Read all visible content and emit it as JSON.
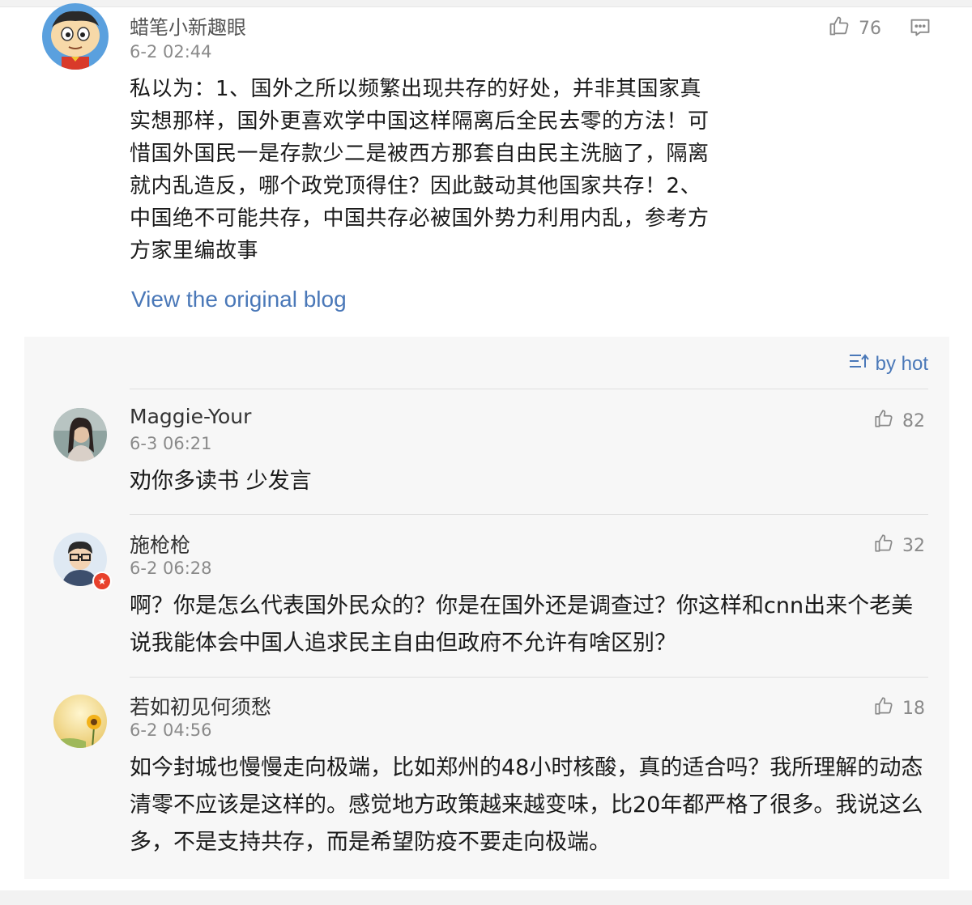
{
  "post": {
    "author": "蜡笔小新趣眼",
    "time": "6-2 02:44",
    "likes": "76",
    "body": "私以为：1、国外之所以频繁出现共存的好处，并非其国家真实想那样，国外更喜欢学中国这样隔离后全民去零的方法！可惜国外国民一是存款少二是被西方那套自由民主洗脑了，隔离就内乱造反，哪个政党顶得住？因此鼓动其他国家共存！2、中国绝不可能共存，中国共存必被国外势力利用内乱，参考方方家里编故事",
    "view_original": "View the original blog"
  },
  "comments_panel": {
    "sort_label": "by hot",
    "comments": [
      {
        "author": "Maggie-Your",
        "time": "6-3 06:21",
        "likes": "82",
        "body": "劝你多读书 少发言"
      },
      {
        "author": "施枪枪",
        "time": "6-2 06:28",
        "likes": "32",
        "body": "啊？你是怎么代表国外民众的？你是在国外还是调查过？你这样和cnn出来个老美说我能体会中国人追求民主自由但政府不允许有啥区别？"
      },
      {
        "author": "若如初见何须愁",
        "time": "6-2 04:56",
        "likes": "18",
        "body": "如今封城也慢慢走向极端，比如郑州的48小时核酸，真的适合吗？我所理解的动态清零不应该是这样的。感觉地方政策越来越变味，比20年都严格了很多。我说这么多，不是支持共存，而是希望防疫不要走向极端。"
      }
    ]
  },
  "colors": {
    "link": "#4a78b8",
    "meta": "#8a8a8a",
    "panel_bg": "#f7f7f7"
  },
  "icons": [
    "thumbs-up-icon",
    "reply-icon",
    "sort-icon"
  ]
}
